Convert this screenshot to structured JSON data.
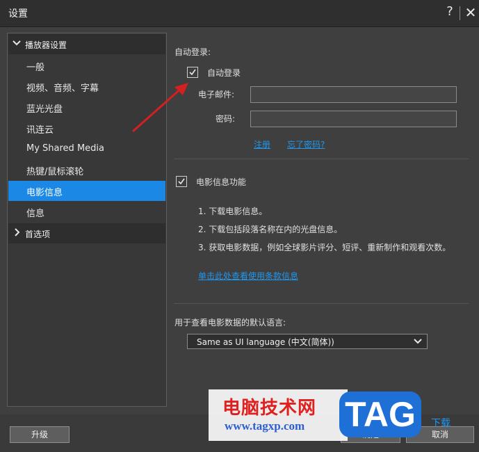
{
  "window": {
    "title": "设置",
    "help": "?",
    "close": "✕"
  },
  "sidebar": {
    "groups": [
      {
        "label": "播放器设置",
        "expanded": true
      },
      {
        "label": "首选项",
        "expanded": false
      }
    ],
    "items": [
      {
        "label": "一般"
      },
      {
        "label": "视频、音频、字幕"
      },
      {
        "label": "蓝光光盘"
      },
      {
        "label": "讯连云"
      },
      {
        "label": "My Shared Media"
      },
      {
        "label": "热键/鼠标滚轮"
      },
      {
        "label": "电影信息",
        "selected": true
      },
      {
        "label": "信息"
      }
    ]
  },
  "autologin": {
    "section_label": "自动登录:",
    "checkbox_label": "自动登录",
    "checked": true,
    "email_label": "电子邮件:",
    "email_value": "",
    "password_label": "密码:",
    "password_value": "",
    "register_link": "注册",
    "forgot_link": "忘了密码?"
  },
  "movieinfo": {
    "checkbox_label": "电影信息功能",
    "checked": true,
    "points": [
      "1. 下载电影信息。",
      "2. 下载包括段落名称在内的光盘信息。",
      "3. 获取电影数据，例如全球影片评分、短评、重新制作和观看次数。"
    ],
    "terms_link": "单击此处查看使用条款信息"
  },
  "language": {
    "label": "用于查看电影数据的默认语言:",
    "selected": "Same as UI language (中文(简体))"
  },
  "buttons": {
    "upgrade": "升级",
    "ok": "确定",
    "cancel": "取消"
  },
  "watermark": {
    "site_name": "电脑技术网",
    "url": "www.tagxp.com",
    "badge": "TAG",
    "extra": "下载"
  },
  "colors": {
    "accent": "#1b88e6",
    "link": "#1e98f0",
    "annotation_arrow": "#d42020",
    "watermark_red": "#e01f1f",
    "watermark_blue": "#1e6fd6"
  }
}
